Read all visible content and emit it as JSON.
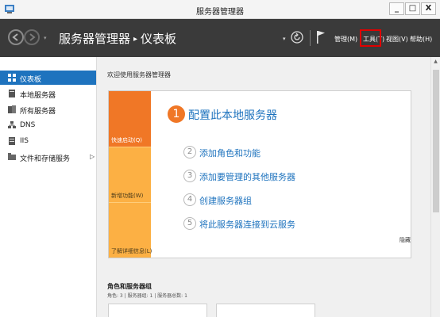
{
  "window": {
    "title": "服务器管理器",
    "min_label": "_",
    "max_label": "□",
    "close_label": "X"
  },
  "header": {
    "nav_dropdown": "▾",
    "breadcrumb_root": "服务器管理器",
    "breadcrumb_sep": "▸",
    "breadcrumb_current": "仪表板",
    "dropdown": "▾",
    "menu": {
      "manage": "管理(M)",
      "tools": "工具(T)",
      "view": "视图(V)",
      "help": "帮助(H)"
    }
  },
  "sidebar": {
    "items": [
      {
        "label": "仪表板",
        "icon": "dashboard-icon",
        "active": true
      },
      {
        "label": "本地服务器",
        "icon": "server-icon"
      },
      {
        "label": "所有服务器",
        "icon": "servers-icon"
      },
      {
        "label": "DNS",
        "icon": "dns-icon"
      },
      {
        "label": "IIS",
        "icon": "iis-icon"
      },
      {
        "label": "文件和存储服务",
        "icon": "storage-icon",
        "chevron": "▷"
      }
    ]
  },
  "main": {
    "welcome": "欢迎使用服务器管理器",
    "quick_start": "快速启动(Q)",
    "whats_new": "新增功能(W)",
    "learn_more": "了解详细信息(L)",
    "main_step": {
      "num": "1",
      "text": "配置此本地服务器"
    },
    "steps": [
      {
        "num": "2",
        "text": "添加角色和功能"
      },
      {
        "num": "3",
        "text": "添加要管理的其他服务器"
      },
      {
        "num": "4",
        "text": "创建服务器组"
      },
      {
        "num": "5",
        "text": "将此服务器连接到云服务"
      }
    ],
    "hide": "隐藏",
    "roles_title": "角色和服务器组",
    "roles_sub": "角色: 3 | 服务器组: 1 | 服务器总数: 1"
  },
  "scrollbar": {
    "up": "▲"
  },
  "colors": {
    "header_bg": "#3a3a3a",
    "accent_blue": "#1e73be",
    "orange": "#f07726",
    "light_orange": "#fcb044",
    "highlight_red": "#e00000"
  }
}
